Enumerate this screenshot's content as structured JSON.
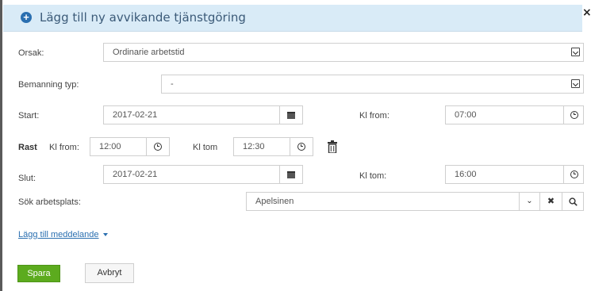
{
  "dialog": {
    "title": "Lägg till ny avvikande tjänstgöring",
    "close": "×"
  },
  "form": {
    "orsak": {
      "label": "Orsak:",
      "value": "Ordinarie arbetstid"
    },
    "bemanning": {
      "label": "Bemanning typ:",
      "value": "-"
    },
    "start": {
      "label": "Start:",
      "date": "2017-02-21",
      "kl_from_label": "Kl from:",
      "kl_from": "07:00"
    },
    "rast": {
      "label": "Rast",
      "kl_from_label": "Kl from:",
      "kl_from": "12:00",
      "kl_tom_label": "Kl tom",
      "kl_tom": "12:30"
    },
    "slut": {
      "label": "Slut:",
      "date": "2017-02-21",
      "kl_tom_label": "Kl tom:",
      "kl_tom": "16:00"
    },
    "arbetsplats": {
      "label": "Sök arbetsplats:",
      "value": "Apelsinen"
    }
  },
  "links": {
    "add_message": "Lägg till meddelande"
  },
  "buttons": {
    "save": "Spara",
    "cancel": "Avbryt"
  },
  "colors": {
    "header_bg": "#d9ebf7",
    "accent": "#2a6fb0",
    "save_bg": "#5cab1e"
  }
}
